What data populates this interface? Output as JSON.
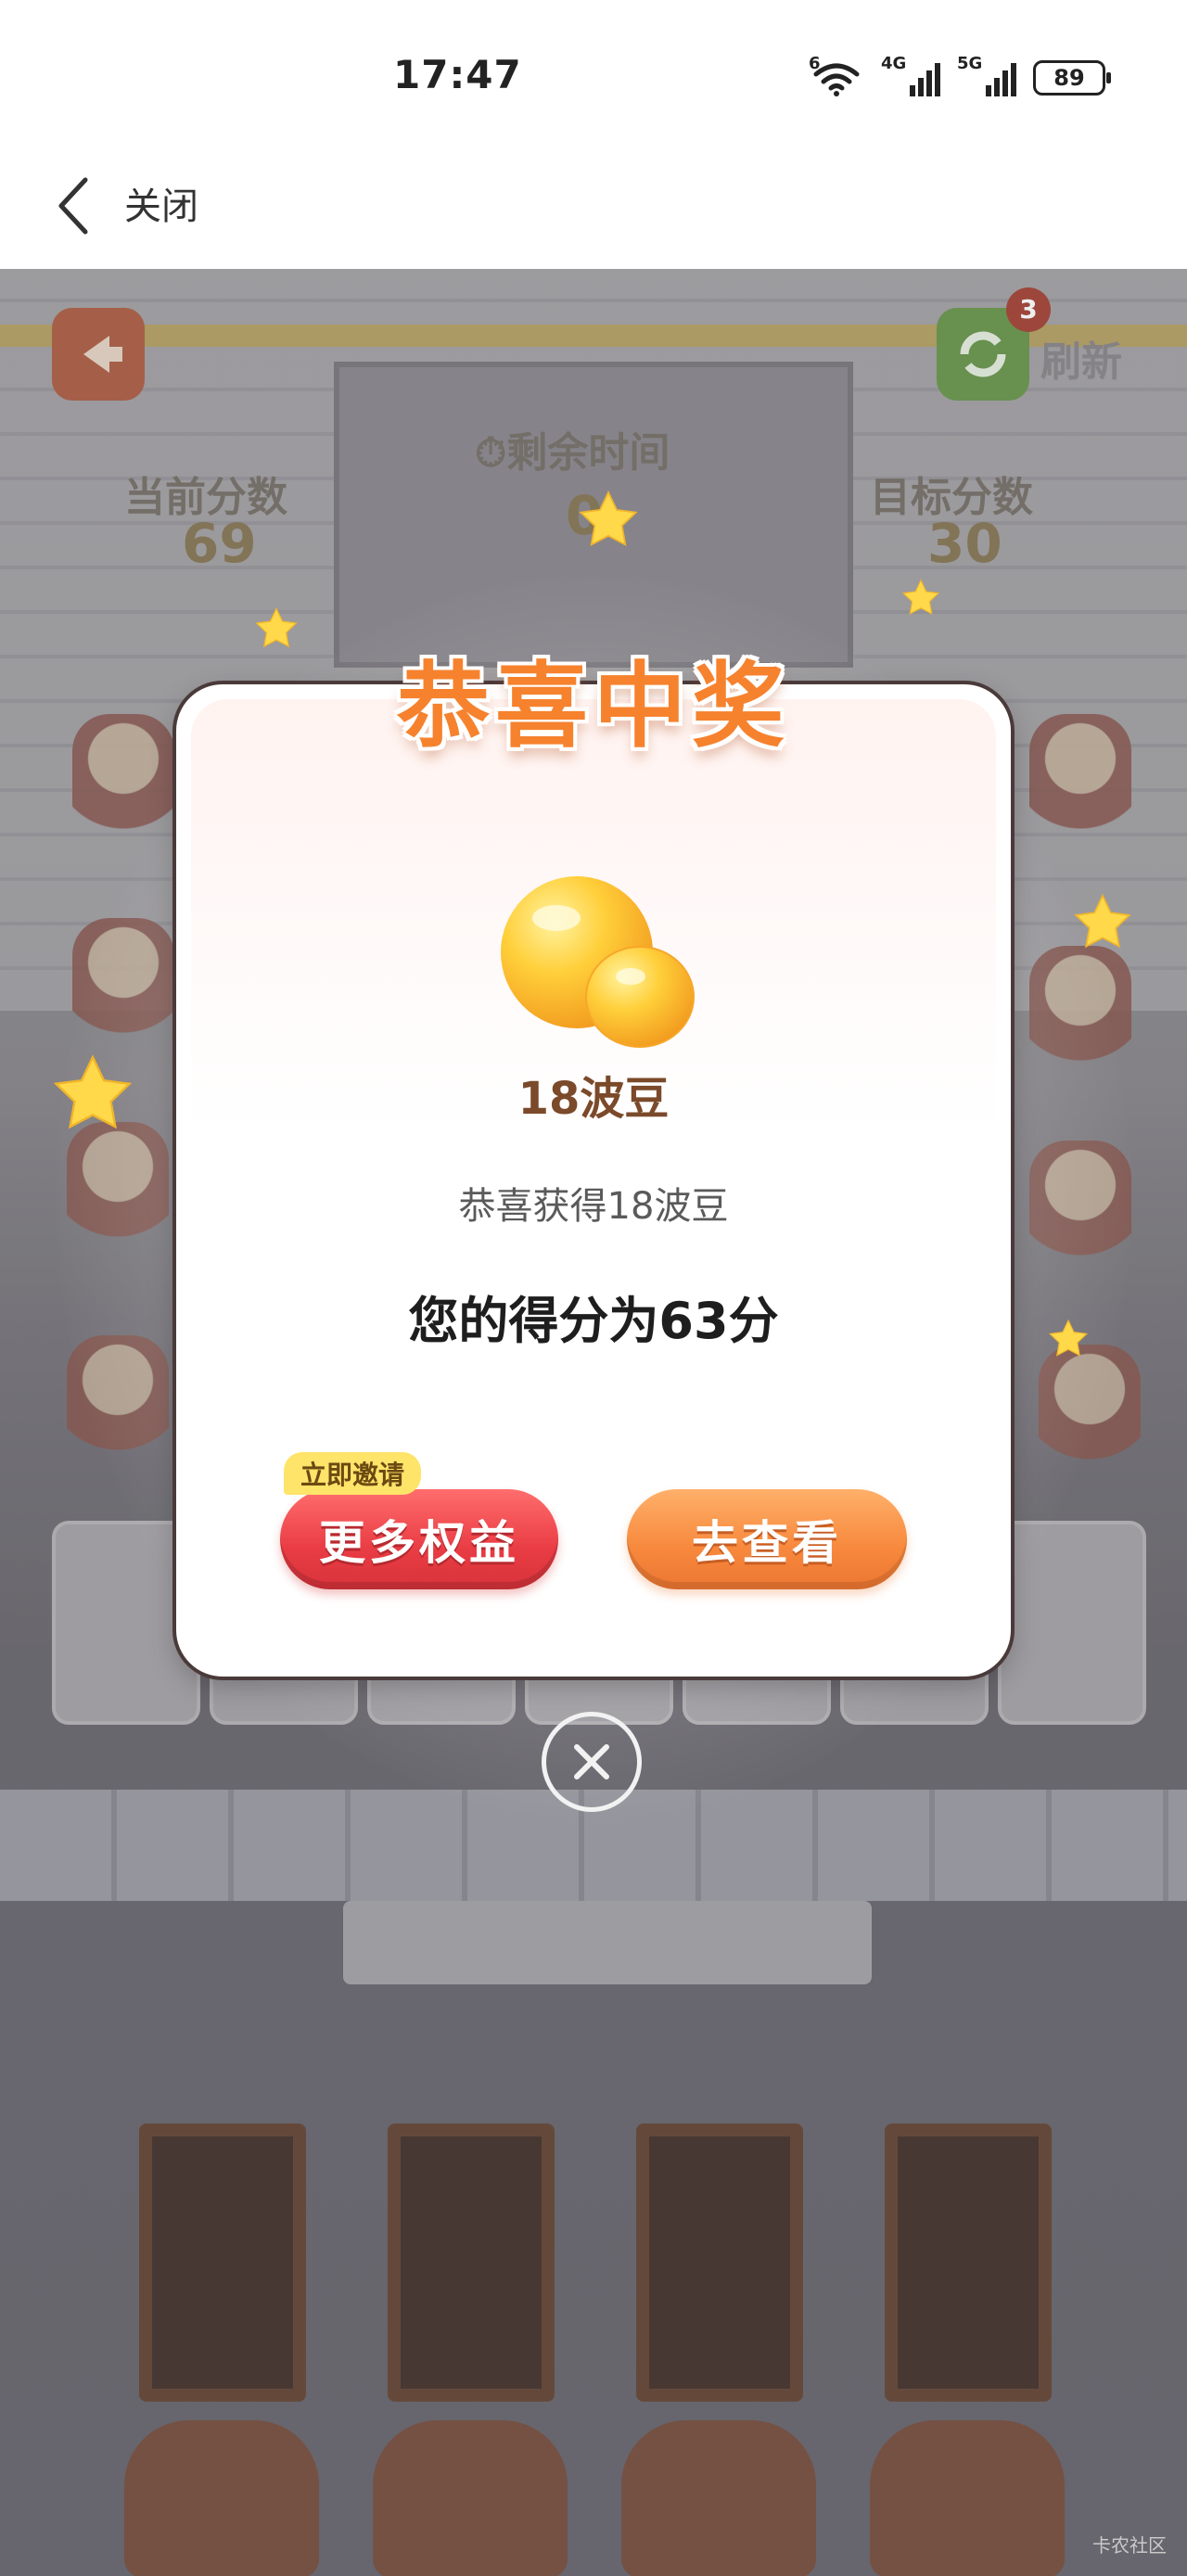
{
  "status_bar": {
    "time": "17:47",
    "wifi_tag": "6",
    "signal_1_tag": "4G",
    "signal_2_tag": "5G",
    "battery": "89"
  },
  "nav": {
    "back_icon": "chevron-left-icon",
    "close_label": "关闭"
  },
  "game": {
    "refresh_badge": "3",
    "refresh_label": "刷新",
    "current_score_label": "当前分数",
    "current_score_value": "69",
    "time_label": "剩余时间",
    "time_value": "0",
    "target_score_label": "目标分数",
    "target_score_value": "30"
  },
  "modal": {
    "title": "恭喜中奖",
    "prize_icon": "beans-icon",
    "prize_name": "18波豆",
    "prize_desc": "恭喜获得18波豆",
    "score_text": "您的得分为63分",
    "invite_tag": "立即邀请",
    "more_button": "更多权益",
    "view_button": "去查看",
    "close_icon": "close-circle-icon"
  },
  "watermark": "卡农社区",
  "colors": {
    "title_orange": "#f6822e",
    "button_red": "#e93c44",
    "button_orange": "#f7883c",
    "tag_yellow": "#ffe46a",
    "prize_brown": "#7b4a2a"
  }
}
